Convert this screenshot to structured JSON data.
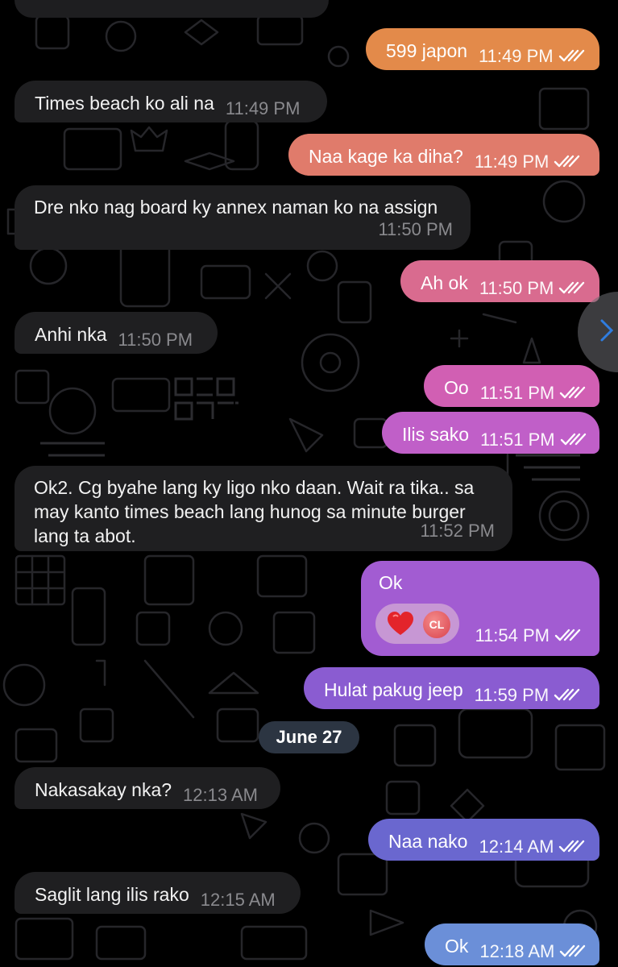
{
  "date_separator": "June 27",
  "messages": [
    {
      "dir": "out",
      "text": "599 japon",
      "time": "11:49 PM"
    },
    {
      "dir": "in",
      "text": "Times beach ko ali na",
      "time": "11:49 PM"
    },
    {
      "dir": "out",
      "text": "Naa kage ka diha?",
      "time": "11:49 PM"
    },
    {
      "dir": "in",
      "text": "Dre nko nag board ky annex naman ko na assign",
      "time": "11:50 PM"
    },
    {
      "dir": "out",
      "text": "Ah ok",
      "time": "11:50 PM"
    },
    {
      "dir": "in",
      "text": "Anhi nka",
      "time": "11:50 PM"
    },
    {
      "dir": "out",
      "text": "Oo",
      "time": "11:51 PM"
    },
    {
      "dir": "out",
      "text": "Ilis sako",
      "time": "11:51 PM"
    },
    {
      "dir": "in",
      "text": "Ok2. Cg byahe lang ky ligo nko daan. Wait ra tika.. sa may kanto times beach lang hunog sa minute burger lang ta abot.",
      "time": "11:52 PM"
    },
    {
      "dir": "out",
      "text": "Ok",
      "time": "11:54 PM",
      "reaction": {
        "emoji": "❤️",
        "avatar_initials": "CL"
      }
    },
    {
      "dir": "out",
      "text": "Hulat pakug jeep",
      "time": "11:59 PM"
    },
    {
      "dir": "in",
      "text": "Nakasakay nka?",
      "time": "12:13 AM"
    },
    {
      "dir": "out",
      "text": "Naa nako",
      "time": "12:14 AM"
    },
    {
      "dir": "in",
      "text": "Saglit lang ilis rako",
      "time": "12:15 AM"
    },
    {
      "dir": "out",
      "text": "Ok",
      "time": "12:18 AM"
    }
  ],
  "colors": {
    "background": "#000000",
    "incoming_bubble": "#1f1f21",
    "date_chip": "#2c3542",
    "outgoing_gradient": [
      "#e38a4a",
      "#e07b6b",
      "#d96b8f",
      "#d15fb3",
      "#b75ed0",
      "#9d5cd2",
      "#7f5dd0",
      "#6a6bd0",
      "#6b8fd8"
    ]
  }
}
